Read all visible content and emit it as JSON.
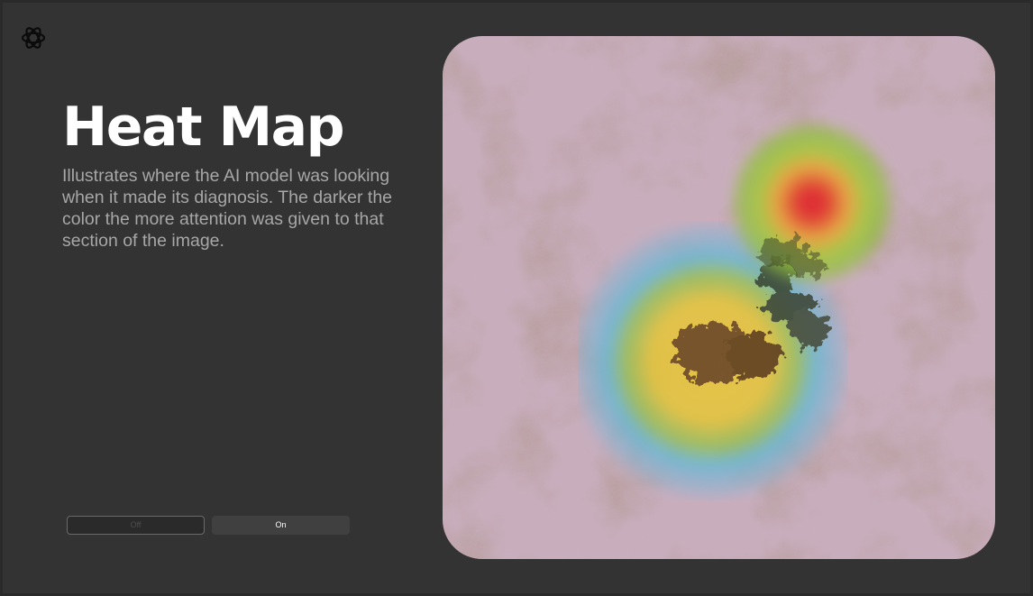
{
  "page": {
    "title": "Heat Map",
    "description": "Illustrates where the AI model was looking when it made its diagnosis. The darker the color the more attention was given to that section of the image.",
    "logo_icon": "openai-logo-icon",
    "background_color": "#333333",
    "text_color": "#ffffff",
    "description_color": "#a7a7a7"
  },
  "toggle": {
    "off_label": "Off",
    "on_label": "On",
    "selected": "On"
  },
  "image": {
    "alt": "Dermoscopy skin lesion image with heat map overlay",
    "overlay_colors": [
      "#e0262a",
      "#8fc13a",
      "#e6c83a",
      "#5fb8d8"
    ]
  }
}
